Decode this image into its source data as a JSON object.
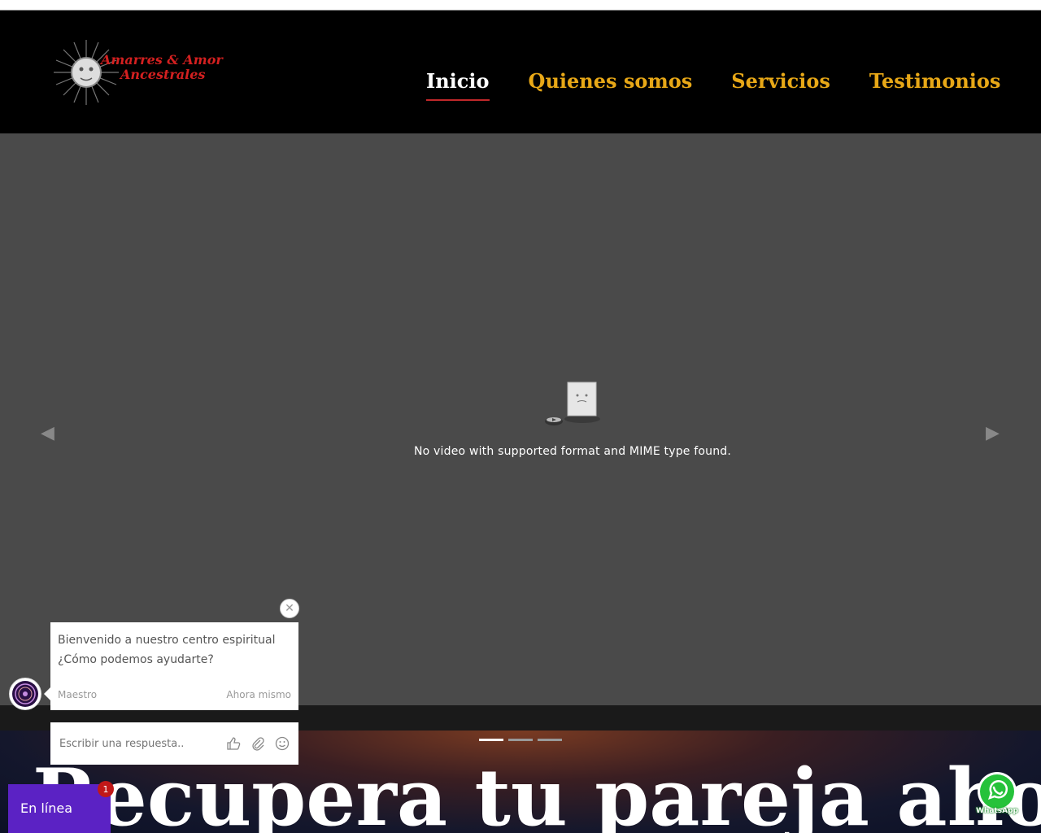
{
  "brand": {
    "line1": "Amarres & Amor",
    "line2": "Ancestrales"
  },
  "nav": [
    {
      "label": "Inicio",
      "active": true
    },
    {
      "label": "Quienes somos",
      "active": false
    },
    {
      "label": "Servicios",
      "active": false
    },
    {
      "label": "Testimonios",
      "active": false
    }
  ],
  "video": {
    "message": "No video with supported format and MIME type found."
  },
  "hero": {
    "title": "Recupera tu pareja ahora"
  },
  "carousel": {
    "slides": 3,
    "active": 0
  },
  "chat": {
    "message_line1": "Bienvenido a nuestro centro espiritual",
    "message_line2": "¿Cómo podemos ayudarte?",
    "author": "Maestro",
    "time": "Ahora mismo",
    "reply_placeholder": "Escribir una respuesta..",
    "status": "En línea",
    "unread": "1"
  },
  "whatsapp": {
    "label": "WhatsApp"
  },
  "colors": {
    "nav_gold": "#e8a817",
    "active_underline": "#c0282a",
    "chat_purple": "#5b22c4",
    "badge_red": "#c01818"
  }
}
